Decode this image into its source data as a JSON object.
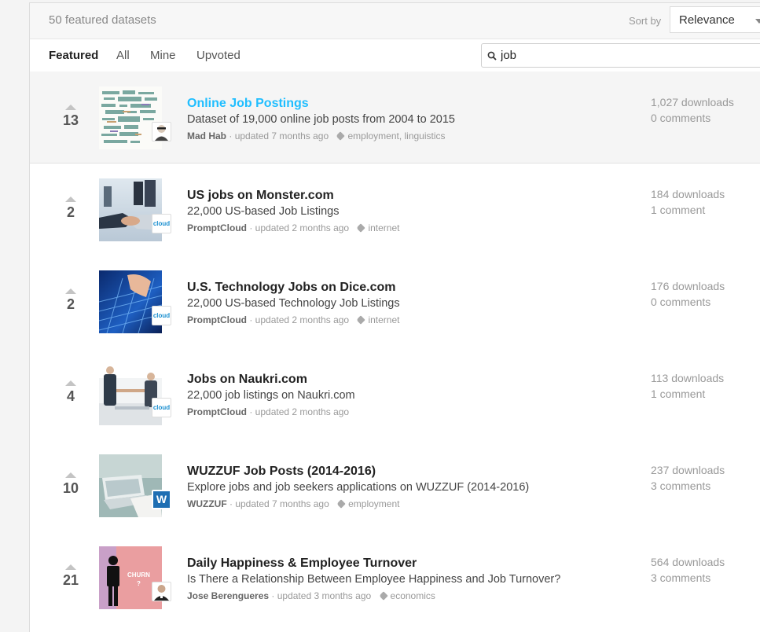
{
  "header": {
    "count_text": "50 featured datasets",
    "sort_label": "Sort by",
    "sort_value": "Relevance"
  },
  "tabs": [
    "Featured",
    "All",
    "Mine",
    "Upvoted"
  ],
  "search": {
    "value": "job"
  },
  "datasets": [
    {
      "votes": "13",
      "title": "Online Job Postings",
      "subtitle": "Dataset of 19,000 online job posts from 2004 to 2015",
      "owner": "Mad Hab",
      "updated": "· updated 7 months ago",
      "tags": "employment, linguistics",
      "downloads": "1,027 downloads",
      "comments": "0 comments"
    },
    {
      "votes": "2",
      "title": "US jobs on Monster.com",
      "subtitle": "22,000 US-based Job Listings",
      "owner": "PromptCloud",
      "updated": "· updated 2 months ago",
      "tags": "internet",
      "downloads": "184 downloads",
      "comments": "1 comment"
    },
    {
      "votes": "2",
      "title": "U.S. Technology Jobs on Dice.com",
      "subtitle": "22,000 US-based Technology Job Listings",
      "owner": "PromptCloud",
      "updated": "· updated 2 months ago",
      "tags": "internet",
      "downloads": "176 downloads",
      "comments": "0 comments"
    },
    {
      "votes": "4",
      "title": "Jobs on Naukri.com",
      "subtitle": "22,000 job listings on Naukri.com",
      "owner": "PromptCloud",
      "updated": "· updated 2 months ago",
      "tags": "",
      "downloads": "113 downloads",
      "comments": "1 comment"
    },
    {
      "votes": "10",
      "title": "WUZZUF Job Posts (2014-2016)",
      "subtitle": "Explore jobs and job seekers applications on WUZZUF (2014-2016)",
      "owner": "WUZZUF",
      "updated": "· updated 7 months ago",
      "tags": "employment",
      "downloads": "237 downloads",
      "comments": "3 comments"
    },
    {
      "votes": "21",
      "title": "Daily Happiness & Employee Turnover",
      "subtitle": "Is There a Relationship Between Employee Happiness and Job Turnover?",
      "owner": "Jose Berengueres",
      "updated": "· updated 3 months ago",
      "tags": "economics",
      "downloads": "564 downloads",
      "comments": "3 comments"
    }
  ],
  "thumb_text": {
    "cloud": "cloud",
    "wuzzuf_badge": "W",
    "churn": "CHURN",
    "churn_q": "?"
  }
}
